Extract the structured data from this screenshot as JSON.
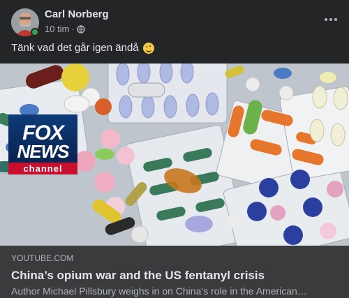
{
  "post": {
    "author": "Carl Norberg",
    "time": "10 tim",
    "separator": "·",
    "audience_icon": "globe-icon",
    "more_icon": "more-options-icon",
    "text": "Tänk vad det går igen ändå",
    "emoji": "winking-face-with-tongue-emoji"
  },
  "link_preview": {
    "image_description_icon": "pills-photo",
    "logo": {
      "line1": "FOX",
      "line2": "NEWS",
      "line3": "channel"
    },
    "domain": "YOUTUBE.COM",
    "title": "China’s opium war and the US fentanyl crisis",
    "description": "Author Michael Pillsbury weighs in on China’s role in the American…"
  },
  "colors": {
    "background": "#242526",
    "link_box": "#3a3b3c",
    "online": "#31a24c",
    "fox_red": "#c8102e",
    "fox_blue": "#0d3b7a"
  }
}
